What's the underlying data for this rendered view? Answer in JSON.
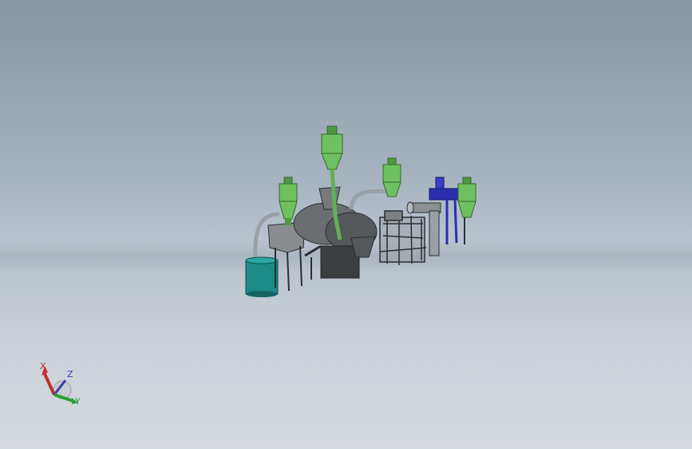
{
  "viewport": {
    "background_top": "#8795a6",
    "background_bottom": "#d6dbe1"
  },
  "model": {
    "colors": {
      "cyclone": "#6fc060",
      "cyclone_dark": "#4e9a44",
      "body": "#6b6e70",
      "body_dark": "#3c3f42",
      "tank": "#1c8a86",
      "blower": "#2a2fb0",
      "frame": "#2b2e31",
      "pipe": "#9aa0a6"
    }
  },
  "triad": {
    "x_label": "X",
    "y_label": "Y",
    "z_label": "Z",
    "x_color": "#c0302a",
    "y_color": "#2aa13a",
    "z_color": "#2f3fb0"
  }
}
